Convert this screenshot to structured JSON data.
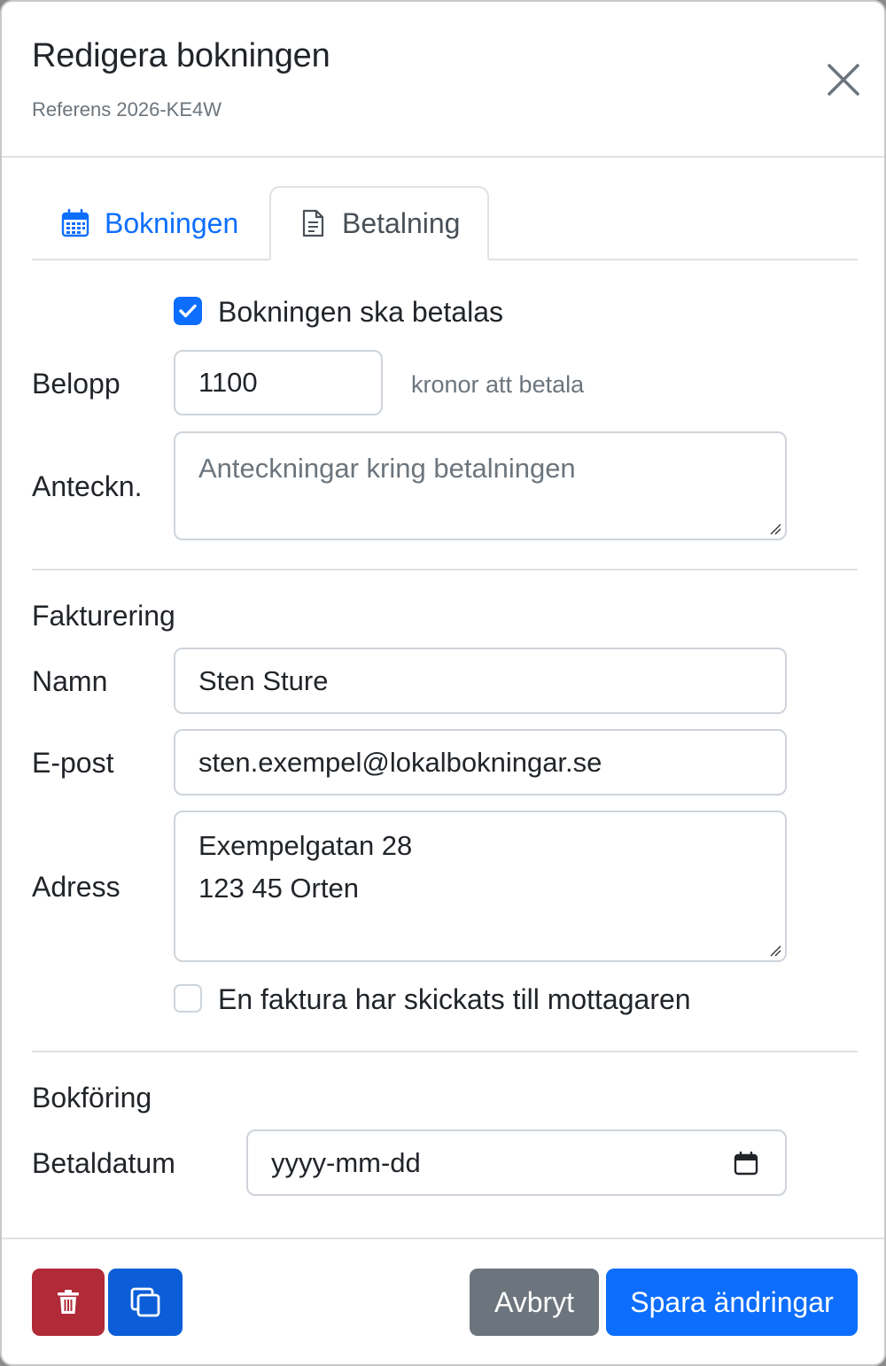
{
  "header": {
    "title": "Redigera bokningen",
    "subtitle": "Referens 2026-KE4W"
  },
  "tabs": [
    {
      "label": "Bokningen",
      "icon": "calendar-icon",
      "active": false
    },
    {
      "label": "Betalning",
      "icon": "document-icon",
      "active": true
    }
  ],
  "payment": {
    "should_pay_label": "Bokningen ska betalas",
    "should_pay_checked": true,
    "amount_label": "Belopp",
    "amount_value": "1100",
    "amount_hint": "kronor att betala",
    "notes_label": "Anteckn.",
    "notes_placeholder": "Anteckningar kring betalningen",
    "notes_value": ""
  },
  "billing": {
    "heading": "Fakturering",
    "name_label": "Namn",
    "name_value": "Sten Sture",
    "email_label": "E-post",
    "email_value": "sten.exempel@lokalbokningar.se",
    "address_label": "Adress",
    "address_value": "Exempelgatan 28\n123 45 Orten",
    "invoice_sent_label": "En faktura har skickats till mottagaren",
    "invoice_sent_checked": false
  },
  "bookkeeping": {
    "heading": "Bokföring",
    "paydate_label": "Betaldatum",
    "paydate_placeholder": "yyyy-mm-dd"
  },
  "footer": {
    "cancel_label": "Avbryt",
    "save_label": "Spara ändringar"
  },
  "colors": {
    "primary": "#0d6efd",
    "danger": "#b02a37",
    "secondary": "#6c757d"
  }
}
